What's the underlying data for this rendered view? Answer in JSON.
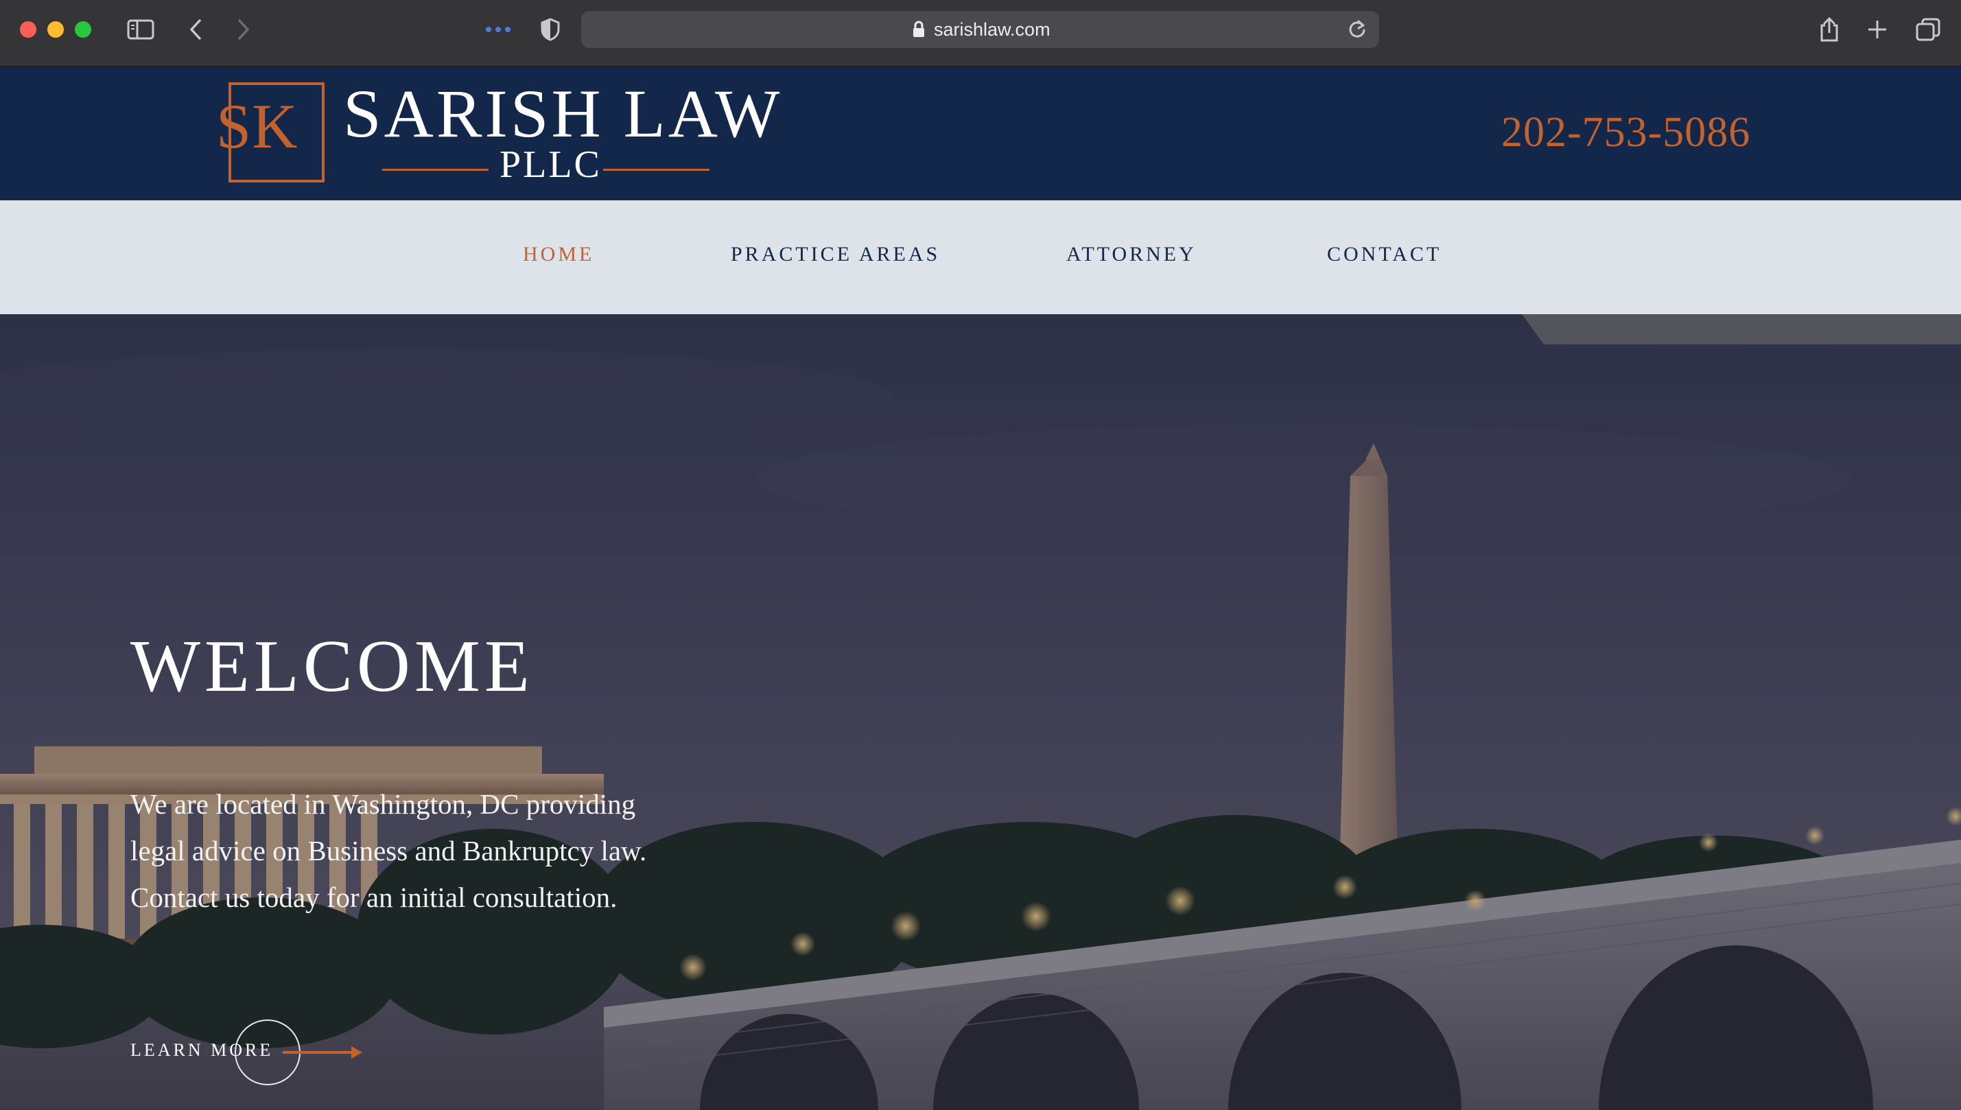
{
  "browser": {
    "url": "sarishlaw.com",
    "icons": [
      "sidebar-icon",
      "back-icon",
      "forward-icon",
      "extensions-icon",
      "privacy-shield-icon",
      "lock-icon",
      "reload-icon",
      "share-icon",
      "new-tab-icon",
      "tab-overview-icon"
    ]
  },
  "header": {
    "logo_monogram": "SK",
    "logo_name": "SARISH LAW",
    "logo_suffix": "PLLC",
    "phone": "202-753-5086"
  },
  "nav": {
    "items": [
      {
        "label": "HOME",
        "active": true
      },
      {
        "label": "PRACTICE AREAS",
        "active": false
      },
      {
        "label": "ATTORNEY",
        "active": false
      },
      {
        "label": "CONTACT",
        "active": false
      }
    ]
  },
  "hero": {
    "title": "WELCOME",
    "body_lines": [
      "We are located in Washington, DC providing",
      "legal advice on Business and Bankruptcy law.",
      "Contact us today for an initial consultation."
    ],
    "cta_label": "LEARN MORE"
  },
  "colors": {
    "brand_navy": "#13274a",
    "accent_orange": "#c4622d",
    "nav_background": "#dde3e9",
    "chrome_background": "#353537"
  }
}
